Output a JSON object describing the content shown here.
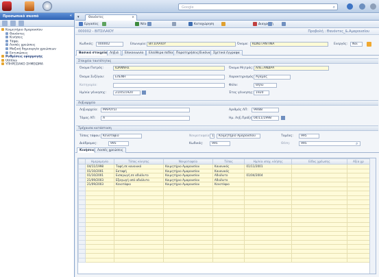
{
  "search": {
    "placeholder": "Google"
  },
  "sidebar": {
    "title": "Προσωπικό σκοπό",
    "items": [
      {
        "label": "Κοιμητήριο Αμαρουσίου",
        "indent": 0,
        "bold": false
      },
      {
        "label": "Θανόντες",
        "indent": 1,
        "bold": false
      },
      {
        "label": "Κινήσεις",
        "indent": 1,
        "bold": false
      },
      {
        "label": "Τάφοι",
        "indent": 1,
        "bold": false
      },
      {
        "label": "Λοιπές χρεώσεις",
        "indent": 1,
        "bold": false
      },
      {
        "label": "Μαζική δημιουργία χρεώσεων",
        "indent": 1,
        "bold": false
      },
      {
        "label": "Εκτυπώσεις",
        "indent": 1,
        "bold": false
      },
      {
        "label": "Ρυθμίσεις εφαρμογής",
        "indent": 0,
        "bold": true
      },
      {
        "label": "Utilities",
        "indent": 0,
        "bold": false
      },
      {
        "label": "ΥΠΗΡΕΣΙΑΚΟ ΣΗΜΕΙΩΜΑ",
        "indent": 0,
        "bold": false
      }
    ]
  },
  "tab": {
    "label": "Θανόντες"
  },
  "toolbar": {
    "buttons": [
      "Εργασίες",
      "",
      "Νέο",
      "",
      "",
      "Καταχώρηση",
      "",
      "Διαγραφή",
      "",
      ""
    ]
  },
  "record": {
    "title": "000002 - ΒΙΤΣΙΛΑΙΟΥ",
    "breadcrumb": "Προβολή : Θανόντες_&.Αμαρουσίου",
    "code_label": "Κωδικός:",
    "code": "000002",
    "surname_label": "Επωνυμία:",
    "surname": "ΒΙΤΣΙΛΑΙΟΥ",
    "name_label": "Όνομα:",
    "name": "ΚΩΝΣΤΑΝΤΙΝΑ",
    "active_label": "Ενεργός:",
    "active": "Ναι"
  },
  "subtabs": [
    "Βασικά στοιχεία",
    "Ληξιά",
    "Επικοινωνία",
    "Ελεύθερα πεδία",
    "Παρατηρήσεις/Εικόνα",
    "Σχετικά έγγραφα"
  ],
  "personal": {
    "section": "Στοιχεία ταυτότητας",
    "father_label": "Όνομα Πατρός:",
    "father": "ΙΩΑΝΝΗΣ",
    "mother_label": "Όνομα Μητρός:",
    "mother": "ΑΛΕΞΑΝΔΡΑ",
    "spouse_label": "Όνομα Συζύγου:",
    "spouse": "ΕΛΕΝΗ",
    "status_label": "Χαρακτηρισμός:",
    "status": "Αγαμος",
    "category_label": "Κατηγορία:",
    "category": "",
    "gender_label": "Φύλο:",
    "gender": "Θήλυ",
    "birthdate_label": "Ημ/νία γέννησης:",
    "birthdate": "21/05/1920",
    "birthyear_label": "Έτος γέννησης:",
    "birthyear": "1920"
  },
  "registry": {
    "section": "Ληξιαρχείο",
    "registry_label": "Ληξιαρχείο:",
    "registry": "ΜΑΡΟΥΣΙ",
    "number_label": "Αριθμός ΛΠ:",
    "number": "99/88",
    "volume_label": "Τόμος ΛΠ:",
    "volume": "Α",
    "date_label": "Ημ. Ληξ.Πράξης:",
    "date": "04/11/1998"
  },
  "burial": {
    "section": "Τρέχουσα κατάσταση",
    "type_label": "Τύπος τάφου:",
    "type": "Κενοτάφιο",
    "cemetery_label": "Νεκροταφείο:",
    "cemetery_no": "1",
    "cemetery": "Κοιμητήριο Αμαρουσίου",
    "sector_label": "Τομέας:",
    "sector": "995",
    "block_label": "Διάδρομος:",
    "block": "995",
    "code_label": "Κωδικός:",
    "code": "995",
    "grave_label": "Θέση:",
    "grave": "995"
  },
  "movements_tabs": [
    "Κινήσεις",
    "Λοιπές χρεώσεις"
  ],
  "table": {
    "columns": [
      "Ημερομηνία",
      "Τύπος κίνησης",
      "Νεκροταφείο",
      "Τύπος",
      "Ημ/νία υποχ. κλήσης",
      "Είδος χρέωσης",
      "Αξία χρ"
    ],
    "rows": [
      [
        "04/11/1998",
        "Ταφή σε κανονικό",
        "Κοιμητήριο Αμαρουσίου",
        "Κανονικός",
        "01/11/2001",
        "",
        ""
      ],
      [
        "01/10/2001",
        "Εκταφή",
        "Κοιμητήριο Αμαρουσίου",
        "Κανονικός",
        "",
        "",
        ""
      ],
      [
        "01/10/2001",
        "Εισαγωγή σε αδιάλυτο",
        "Κοιμητήριο Αμαρουσίου",
        "Αδιάλυτο",
        "01/04/2004",
        "",
        ""
      ],
      [
        "21/09/2003",
        "Εξαγωγή από αδιάλυτο",
        "Κοιμητήριο Αμαρουσίου",
        "Αδιάλυτο",
        "",
        "",
        ""
      ],
      [
        "21/09/2003",
        "Κενοτάφιο",
        "Κοιμητήριο Αμαρουσίου",
        "Κενοτάφιο",
        "",
        "",
        ""
      ]
    ]
  }
}
